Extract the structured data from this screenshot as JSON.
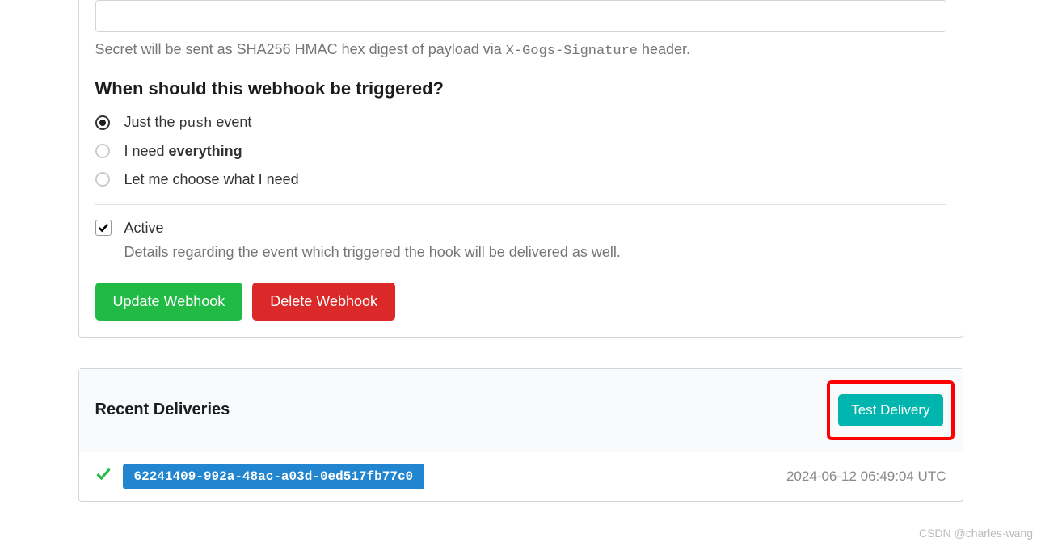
{
  "secret": {
    "help_prefix": "Secret will be sent as SHA256 HMAC hex digest of payload via ",
    "help_code": "X-Gogs-Signature",
    "help_suffix": " header."
  },
  "trigger": {
    "heading": "When should this webhook be triggered?",
    "options": [
      {
        "prefix": "Just the ",
        "code": "push",
        "suffix": " event",
        "selected": true
      },
      {
        "prefix": "I need ",
        "strong": "everything",
        "selected": false
      },
      {
        "prefix": "Let me choose what I need",
        "selected": false
      }
    ]
  },
  "active": {
    "label": "Active",
    "checked": true,
    "help": "Details regarding the event which triggered the hook will be delivered as well."
  },
  "buttons": {
    "update": "Update Webhook",
    "delete": "Delete Webhook",
    "test": "Test Delivery"
  },
  "deliveries": {
    "heading": "Recent Deliveries",
    "items": [
      {
        "id": "62241409-992a-48ac-a03d-0ed517fb77c0",
        "date": "2024-06-12 06:49:04 UTC",
        "success": true
      }
    ]
  },
  "watermark": "CSDN @charles·wang"
}
